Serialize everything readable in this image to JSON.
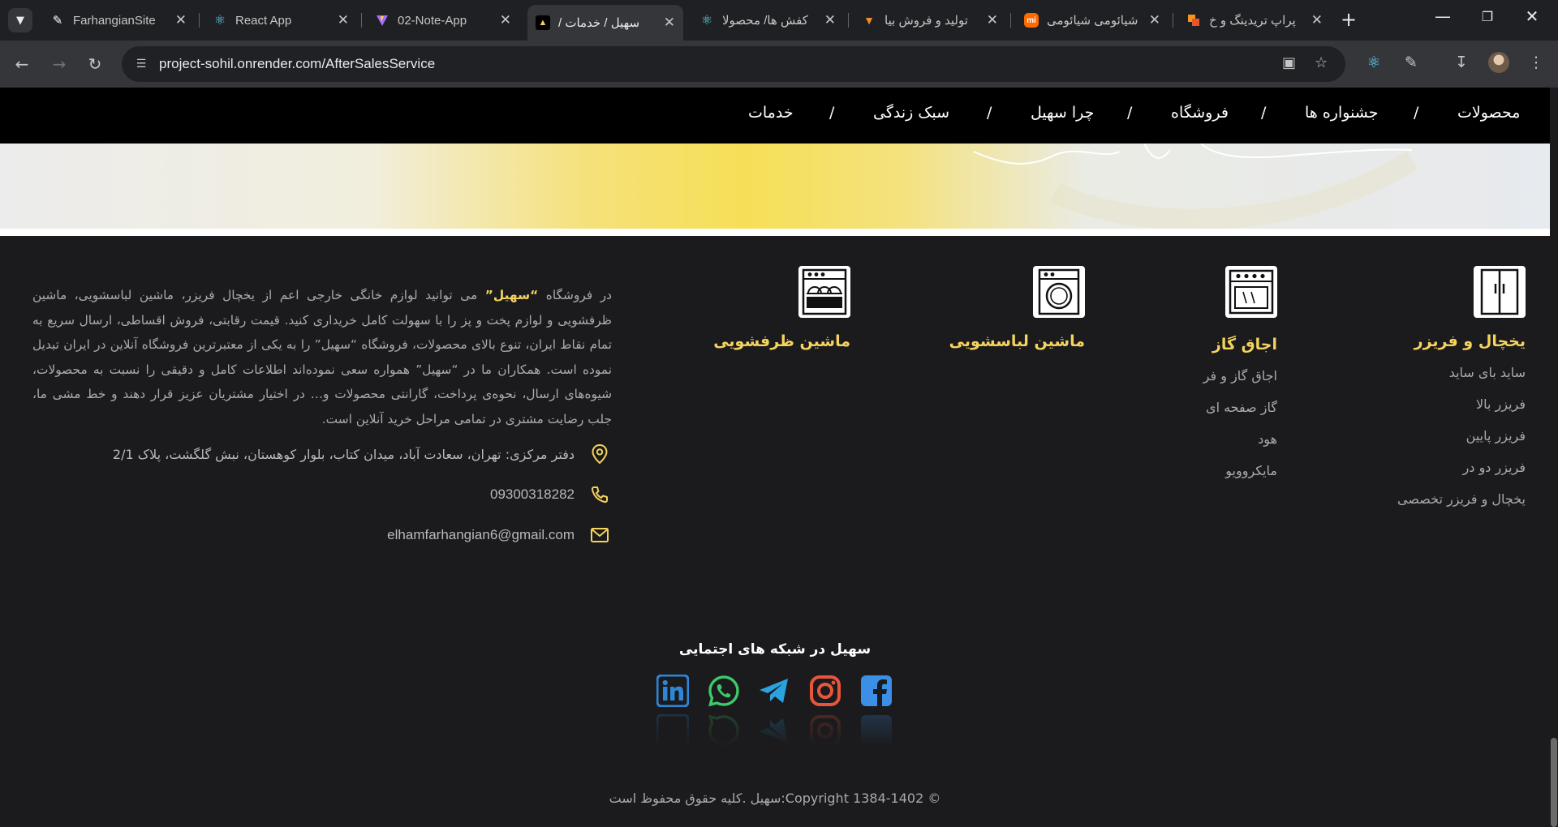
{
  "browser": {
    "tabs": [
      {
        "title": "FarhangianSite",
        "icon": "farhangian-logo-icon",
        "active": false
      },
      {
        "title": "React App",
        "icon": "react-icon",
        "active": false
      },
      {
        "title": "02-Note-App",
        "icon": "vite-icon",
        "active": false
      },
      {
        "title": "سهیل / خدمات /",
        "icon": "sohil-logo-icon",
        "active": true
      },
      {
        "title": "کفش ها/ محصولا",
        "icon": "react-icon",
        "active": false
      },
      {
        "title": "تولید و فروش بیا",
        "icon": "carrot-icon",
        "active": false
      },
      {
        "title": "شیائومی شیائومی",
        "icon": "xiaomi-icon",
        "active": false
      },
      {
        "title": "پراپ تریدینگ و خ",
        "icon": "prop-logo-icon",
        "active": false
      }
    ],
    "url": "project-sohil.onrender.com/AfterSalesService",
    "colors": {
      "chrome_bg": "#1f2023",
      "toolbar_bg": "#35363a",
      "omnibox_bg": "#202124"
    }
  },
  "nav": {
    "items": [
      "محصولات",
      "جشنواره ها",
      "فروشگاه",
      "چرا سهیل",
      "سبک زندگی",
      "خدمات"
    ],
    "separator": "/"
  },
  "categories": [
    {
      "title": "یخچال و فریزر",
      "icon": "refrigerator-icon",
      "items": [
        "ساید بای ساید",
        "فریزر بالا",
        "فریزر پایین",
        "فریزر دو در",
        "یخچال و فریزر تخصصی"
      ]
    },
    {
      "title": "اجاق گاز",
      "icon": "oven-icon",
      "items": [
        "اجاق گاز و فر",
        "گاز صفحه ای",
        "هود",
        "مایکروویو"
      ]
    },
    {
      "title": "ماشین لباسشویی",
      "icon": "washing-machine-icon",
      "items": []
    },
    {
      "title": "ماشین ظرفشویی",
      "icon": "dishwasher-icon",
      "items": []
    }
  ],
  "about": {
    "before": "در فروشگاه ",
    "brand": "“سهیل”",
    "after": " می توانید لوازم خانگی خارجی اعم از یخچال فریزر، ماشین لباسشویی، ماشین ظرفشویی و لوازم پخت و پز را با سهولت کامل خریداری کنید. قیمت رقابتی، فروش اقساطی، ارسال سریع به تمام نقاط ایران، تنوع بالای محصولات، فروشگاه “سهیل” را به یکی از معتبرترین فروشگاه آنلاین در ایران تبدیل نموده است. همکاران ما در “سهیل” همواره سعی نموده‌اند اطلاعات کامل و دقیقی را نسبت به محصولات، شیوه‌های ارسال، نحوه‌ی پرداخت، گارانتی محصولات و… در اختیار مشتریان عزیز قرار دهند و خط مشی ما، جلب رضایت مشتری در تمامی مراحل خرید آنلاین است."
  },
  "contact": {
    "address": "دفتر مرکزی: تهران، سعادت آباد، میدان کتاب، بلوار کوهستان، نبش گلگشت، پلاک 2/1",
    "phone": "09300318282",
    "email": "elhamfarhangian6@gmail.com"
  },
  "social": {
    "title": "سهیل در شبکه های اجتمایی",
    "networks": [
      {
        "name": "facebook",
        "icon": "facebook-icon",
        "color": "#3b8fe6"
      },
      {
        "name": "instagram",
        "icon": "instagram-icon",
        "color": "#e9553a"
      },
      {
        "name": "telegram",
        "icon": "telegram-icon",
        "color": "#2aa3e0"
      },
      {
        "name": "whatsapp",
        "icon": "whatsapp-icon",
        "color": "#3ec96a"
      },
      {
        "name": "linkedin",
        "icon": "linkedin-icon",
        "color": "#2f86d6"
      }
    ]
  },
  "copyright": "© Copyright 1384-1402:سهیل .کلیه حقوق محفوظ است",
  "theme": {
    "accent": "#f4d35e",
    "footer_bg": "#1b1b1d",
    "nav_bg": "#000000",
    "muted_text": "#a9aaac"
  }
}
